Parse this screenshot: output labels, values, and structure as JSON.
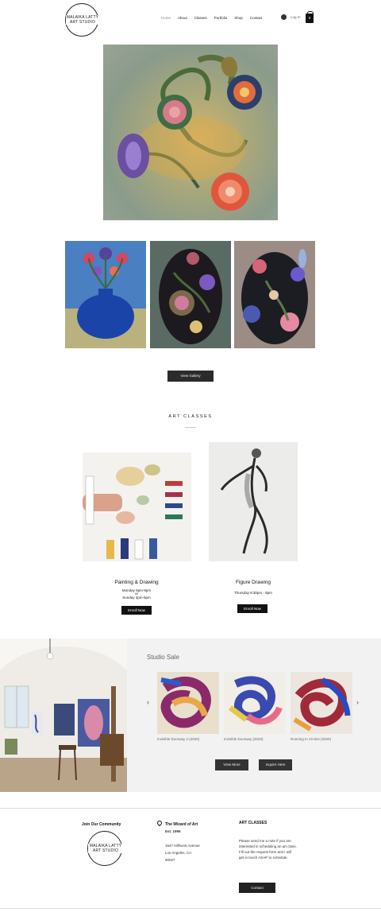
{
  "brand": {
    "logo_text": "MALAIKA LATTY\nART STUDIO"
  },
  "nav": {
    "items": [
      "Home",
      "About",
      "Classes",
      "Portfolio",
      "Shop",
      "Contact"
    ],
    "login": "Log In",
    "cart_count": "0"
  },
  "gallery": {
    "button": "View Gallery"
  },
  "classes": {
    "title": "ART CLASSES",
    "items": [
      {
        "name": "Painting & Drawing",
        "schedule_1": "Monday 6pm-9pm",
        "schedule_or": "or",
        "schedule_2": "Sunday 3pm-6pm",
        "button": "Enroll Now"
      },
      {
        "name": "Figure Drawing",
        "schedule_1": "Thursday 6:30pm - 9pm",
        "button": "Enroll Now"
      }
    ]
  },
  "sale": {
    "title": "Studio Sale",
    "products": [
      {
        "caption": "Invisible Doorway 2 (2020)"
      },
      {
        "caption": "Invisible Doorway (2020)"
      },
      {
        "caption": "Running In Circles (2020)"
      }
    ],
    "prev_icon": "‹",
    "next_icon": "›",
    "view_more": "View More",
    "inquire": "Inquire Here"
  },
  "footer": {
    "community": "Join Our Community",
    "venue_name": "The Wizard of Art",
    "est": "Est. 1996",
    "address_1": "1647 Hillhurst Avenue",
    "address_2": "Los Angeles, CA",
    "address_3": "90027",
    "classes_heading": "ART CLASSES",
    "classes_note_1": "Please send me a note if you are",
    "classes_note_2": "interested in scheduling an art class.",
    "classes_note_3": "Fill out the request form and I will",
    "classes_note_4": "get in touch ASAP to schedule.",
    "contact_button": "Contact"
  },
  "colors": {
    "dark_button": "#2b2b2b",
    "sale_bg": "#f2f2f2"
  }
}
